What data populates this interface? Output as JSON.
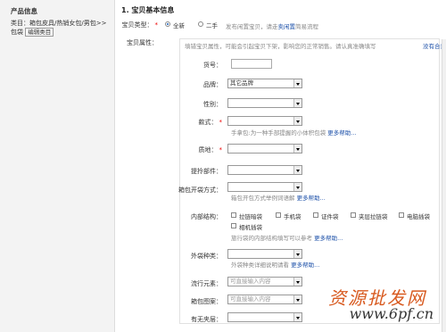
{
  "sidebar": {
    "title": "产品信息",
    "category_text": "类目：箱包皮具/热销女包/男包>>包袋",
    "edit_button": "编辑类目"
  },
  "section": {
    "title": "1. 宝贝基本信息",
    "type_label": "宝贝类型：",
    "type_options": [
      "全新",
      "二手"
    ],
    "type_selected": "全新",
    "type_hint_prefix": "发布闲置宝贝，请走",
    "type_hint_link": "卖闲置",
    "type_hint_suffix": "简易流程",
    "attr_label": "宝贝属性："
  },
  "attrs": {
    "notice": "填错宝贝属性，可能会引起宝贝下架，影响您的正常销售。请认真准确填写",
    "notice_link": "没有合意",
    "model_label": "货号：",
    "brand_label": "品牌：",
    "brand_value": "其它品牌",
    "gender_label": "性别：",
    "style_label": "款式：",
    "style_hint": "手拿包:为一种手部提握的小体积包袋",
    "style_hint_link": "更多帮助...",
    "material_label": "质地：",
    "handle_label": "提拎部件：",
    "opening_label": "箱包开袋方式：",
    "opening_hint": "箱包开包方式举例词语解",
    "opening_hint_link": "更多帮助...",
    "structure_label": "内部结构：",
    "structure_options": [
      "拉链暗袋",
      "手机袋",
      "证件袋",
      "夹层拉链袋",
      "电脑插袋",
      "相机插袋"
    ],
    "structure_hint": "旅行袋的内部结构填写可以参考",
    "structure_hint_link": "更多帮助...",
    "pocket_label": "外袋种类：",
    "pocket_hint": "外袋种类详细说明请看",
    "pocket_hint_link": "更多帮助...",
    "trend_label": "流行元素：",
    "trend_placeholder": "可直接输入内容",
    "pattern_label": "箱包图案：",
    "pattern_placeholder": "可直接输入内容",
    "layer_label": "有无夹层："
  },
  "watermark": {
    "line1": "资源批发网",
    "line2": "www.6pf.cn"
  },
  "colors": {
    "required": "#e00000",
    "link": "#1b4fa8",
    "watermark": "#d85a20"
  }
}
